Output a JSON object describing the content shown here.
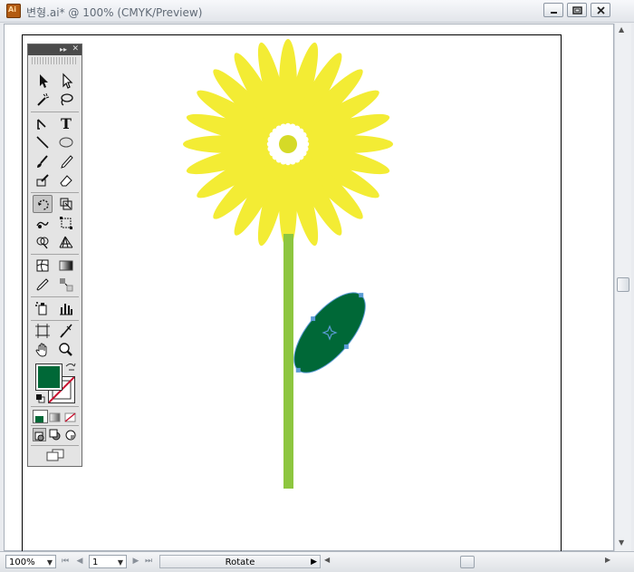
{
  "window": {
    "title": "변형.ai* @ 100% (CMYK/Preview)",
    "icon_label": "Ai",
    "buttons": {
      "minimize": "minimize-icon",
      "restore": "restore-icon",
      "close": "close-icon"
    }
  },
  "colors": {
    "petal": "#F3EC34",
    "flower_center": "#D5DA27",
    "stem": "#8DC63F",
    "leaf": "#006837",
    "selection": "#5B9BD5",
    "fill_swatch": "#006837"
  },
  "toolbox": {
    "tools": [
      "selection-tool-icon",
      "direct-selection-tool-icon",
      "magic-wand-tool-icon",
      "lasso-tool-icon",
      "pen-tool-icon",
      "type-tool-icon",
      "line-segment-tool-icon",
      "ellipse-tool-icon",
      "paintbrush-tool-icon",
      "pencil-tool-icon",
      "blob-brush-tool-icon",
      "eraser-tool-icon",
      "rotate-tool-icon",
      "scale-tool-icon",
      "warp-tool-icon",
      "free-transform-tool-icon",
      "shape-builder-tool-icon",
      "perspective-grid-tool-icon",
      "mesh-tool-icon",
      "gradient-tool-icon",
      "eyedropper-tool-icon",
      "blend-tool-icon",
      "symbol-sprayer-tool-icon",
      "column-graph-tool-icon",
      "artboard-tool-icon",
      "slice-tool-icon",
      "hand-tool-icon",
      "zoom-tool-icon"
    ],
    "active_tool": "rotate-tool-icon"
  },
  "statusbar": {
    "zoom": "100%",
    "page": "1",
    "status_text": "Rotate"
  }
}
